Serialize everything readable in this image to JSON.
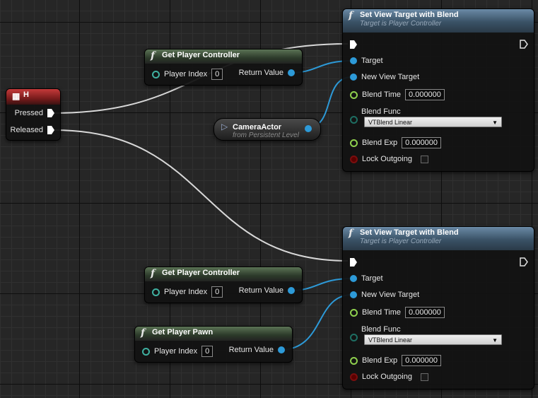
{
  "event_node": {
    "title": "H",
    "pressed": "Pressed",
    "released": "Released"
  },
  "get_player_controller_1": {
    "title": "Get Player Controller",
    "player_index_label": "Player Index",
    "player_index_value": "0",
    "return_label": "Return Value"
  },
  "get_player_controller_2": {
    "title": "Get Player Controller",
    "player_index_label": "Player Index",
    "player_index_value": "0",
    "return_label": "Return Value"
  },
  "get_player_pawn": {
    "title": "Get Player Pawn",
    "player_index_label": "Player Index",
    "player_index_value": "0",
    "return_label": "Return Value"
  },
  "camera_actor": {
    "title": "CameraActor",
    "subtitle": "from Persistent Level"
  },
  "set_view_target_1": {
    "title": "Set View Target with Blend",
    "subtitle": "Target is Player Controller",
    "target_label": "Target",
    "new_view_target_label": "New View Target",
    "blend_time_label": "Blend Time",
    "blend_time_value": "0.000000",
    "blend_func_label": "Blend Func",
    "blend_func_value": "VTBlend Linear",
    "blend_exp_label": "Blend Exp",
    "blend_exp_value": "0.000000",
    "lock_outgoing_label": "Lock Outgoing"
  },
  "set_view_target_2": {
    "title": "Set View Target with Blend",
    "subtitle": "Target is Player Controller",
    "target_label": "Target",
    "new_view_target_label": "New View Target",
    "blend_time_label": "Blend Time",
    "blend_time_value": "0.000000",
    "blend_func_label": "Blend Func",
    "blend_func_value": "VTBlend Linear",
    "blend_exp_label": "Blend Exp",
    "blend_exp_value": "0.000000",
    "lock_outgoing_label": "Lock Outgoing"
  },
  "colors": {
    "exec_wire": "#d8d8d8",
    "object_wire": "#2d9ad8",
    "event_header": "#9c2a2a",
    "pure_function_header": "#3f5a3c",
    "function_header": "#4f6f8a"
  }
}
